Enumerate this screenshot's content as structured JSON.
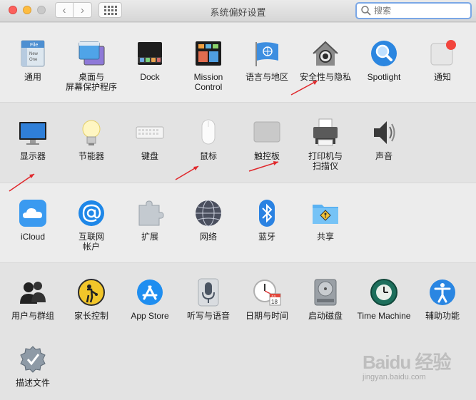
{
  "window": {
    "title": "系统偏好设置"
  },
  "toolbar": {
    "back_glyph": "‹",
    "forward_glyph": "›"
  },
  "search": {
    "placeholder": "搜索",
    "value": ""
  },
  "rows": [
    {
      "items": [
        {
          "id": "general",
          "label": "通用",
          "icon": "general-icon"
        },
        {
          "id": "desktop",
          "label": "桌面与\n屏幕保护程序",
          "icon": "desktop-screensaver-icon"
        },
        {
          "id": "dock",
          "label": "Dock",
          "icon": "dock-icon"
        },
        {
          "id": "mission",
          "label": "Mission\nControl",
          "icon": "mission-control-icon"
        },
        {
          "id": "language",
          "label": "语言与地区",
          "icon": "un-flag-icon"
        },
        {
          "id": "security",
          "label": "安全性与隐私",
          "icon": "house-lock-icon"
        },
        {
          "id": "spotlight",
          "label": "Spotlight",
          "icon": "magnifier-icon"
        },
        {
          "id": "notifications",
          "label": "通知",
          "icon": "notification-icon"
        }
      ]
    },
    {
      "items": [
        {
          "id": "displays",
          "label": "显示器",
          "icon": "monitor-icon"
        },
        {
          "id": "energy",
          "label": "节能器",
          "icon": "light-bulb-icon"
        },
        {
          "id": "keyboard",
          "label": "键盘",
          "icon": "keyboard-icon"
        },
        {
          "id": "mouse",
          "label": "鼠标",
          "icon": "mouse-icon"
        },
        {
          "id": "trackpad",
          "label": "触控板",
          "icon": "trackpad-icon"
        },
        {
          "id": "printers",
          "label": "打印机与\n扫描仪",
          "icon": "printer-icon"
        },
        {
          "id": "sound",
          "label": "声音",
          "icon": "speaker-icon"
        }
      ]
    },
    {
      "items": [
        {
          "id": "icloud",
          "label": "iCloud",
          "icon": "cloud-icon"
        },
        {
          "id": "internet",
          "label": "互联网\n帐户",
          "icon": "at-sign-icon"
        },
        {
          "id": "extensions",
          "label": "扩展",
          "icon": "puzzle-icon"
        },
        {
          "id": "network",
          "label": "网络",
          "icon": "globe-icon"
        },
        {
          "id": "bluetooth",
          "label": "蓝牙",
          "icon": "bluetooth-icon"
        },
        {
          "id": "sharing",
          "label": "共享",
          "icon": "shared-folder-icon"
        }
      ]
    },
    {
      "items": [
        {
          "id": "users",
          "label": "用户与群组",
          "icon": "users-icon"
        },
        {
          "id": "parental",
          "label": "家长控制",
          "icon": "parental-controls-icon"
        },
        {
          "id": "appstore",
          "label": "App Store",
          "icon": "app-store-icon"
        },
        {
          "id": "dictation",
          "label": "听写与语音",
          "icon": "microphone-icon"
        },
        {
          "id": "datetime",
          "label": "日期与时间",
          "icon": "clock-calendar-icon"
        },
        {
          "id": "startup",
          "label": "启动磁盘",
          "icon": "hard-drive-icon"
        },
        {
          "id": "timemachine",
          "label": "Time Machine",
          "icon": "time-machine-icon"
        },
        {
          "id": "accessibility",
          "label": "辅助功能",
          "icon": "accessibility-icon"
        }
      ]
    },
    {
      "items": [
        {
          "id": "profiles",
          "label": "描述文件",
          "icon": "badge-check-icon"
        }
      ]
    }
  ],
  "icon_text": {
    "general_file": "File",
    "general_new": "New",
    "general_one": "One",
    "calendar_month": "JUL",
    "calendar_day": "18"
  },
  "annotations": {
    "arrow_color": "#e0282c"
  },
  "watermark": {
    "logo": "Baidu 经验",
    "url": "jingyan.baidu.com"
  }
}
